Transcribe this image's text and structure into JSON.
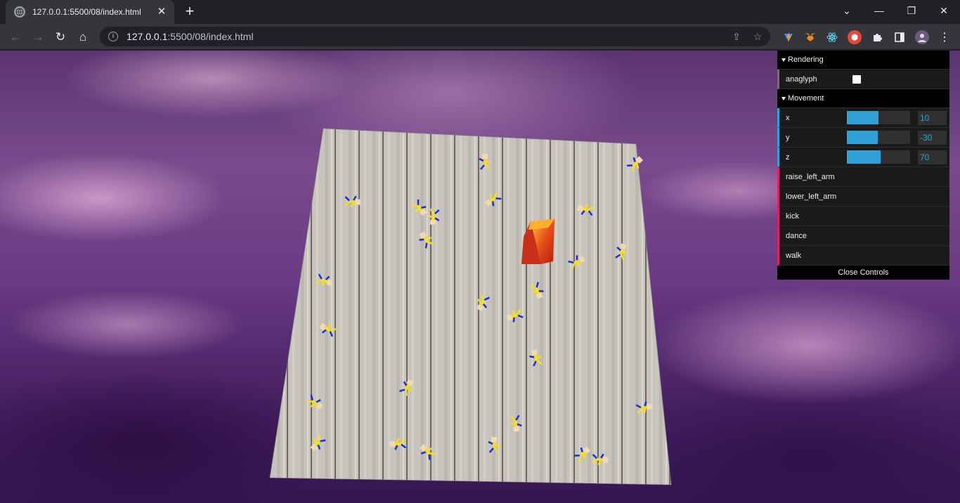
{
  "browser": {
    "tab_title": "127.0.0.1:5500/08/index.html",
    "new_tab_label": "+",
    "url_host": "127.0.0.1",
    "url_rest": ":5500/08/index.html"
  },
  "gui": {
    "rendering_folder": "Rendering",
    "anaglyph_label": "anaglyph",
    "anaglyph_checked": false,
    "movement_folder": "Movement",
    "params": [
      {
        "name": "x",
        "value": "10",
        "fill": 0.5
      },
      {
        "name": "y",
        "value": "-30",
        "fill": 0.49
      },
      {
        "name": "z",
        "value": "70",
        "fill": 0.53
      }
    ],
    "actions": [
      "raise_left_arm",
      "lower_left_arm",
      "kick",
      "dance",
      "walk"
    ],
    "close_label": "Close Controls"
  },
  "colors": {
    "gui_bg": "#1a1a1a",
    "gui_number": "#2fa1d6",
    "gui_function": "#e61d5f",
    "gui_boolean": "#806787",
    "figure_body": "#f5e01a",
    "figure_limbs": "#1b2fd6",
    "cube": "#e0401a"
  },
  "icons": {
    "favicon": "globe-icon",
    "back": "arrow-left-icon",
    "forward": "arrow-right-icon",
    "reload": "reload-icon",
    "home": "home-icon",
    "site_info": "info-icon",
    "share": "share-icon",
    "bookmark": "star-icon",
    "extensions": [
      "vite-extension-icon",
      "metamask-extension-icon",
      "react-devtools-icon",
      "extension-icon",
      "puzzle-icon",
      "side-panel-icon",
      "profile-avatar"
    ],
    "menu": "kebab-menu-icon"
  }
}
